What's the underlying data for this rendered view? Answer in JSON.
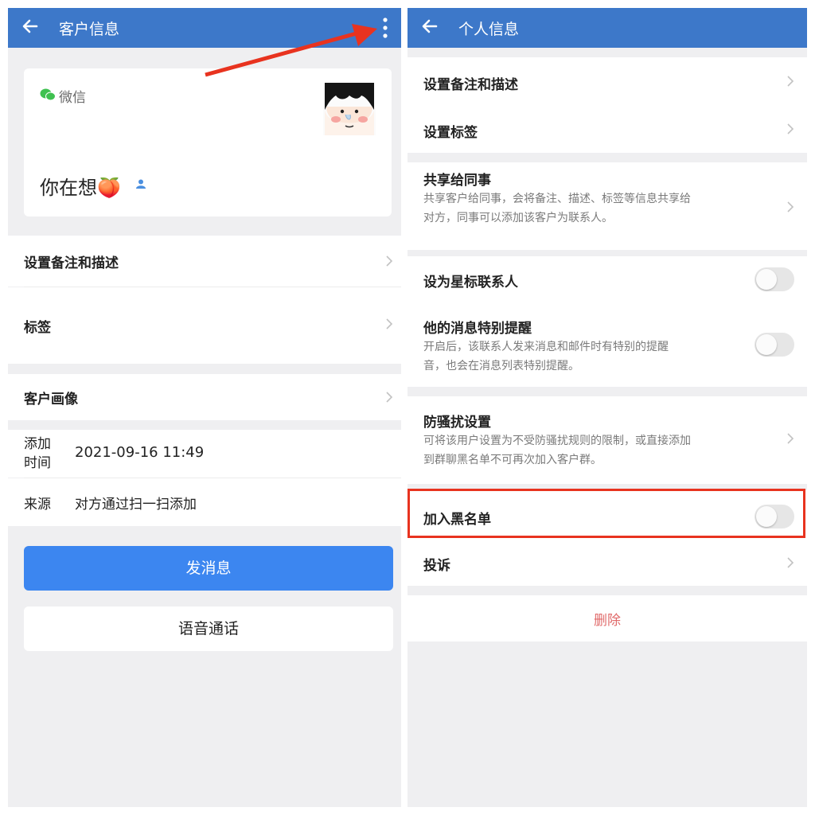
{
  "left": {
    "header": {
      "title": "客户信息"
    },
    "card": {
      "channel_label": "微信",
      "name": "你在想🍑"
    },
    "menu": [
      {
        "label": "设置备注和描述"
      },
      {
        "label": "标签"
      },
      {
        "label": "客户画像"
      }
    ],
    "info": {
      "added_label": "添加\n时间",
      "added_value": "2021-09-16 11:49",
      "source_label": "来源",
      "source_value": "对方通过扫一扫添加"
    },
    "buttons": {
      "send_message": "发消息",
      "voice_call": "语音通话"
    }
  },
  "right": {
    "header": {
      "title": "个人信息"
    },
    "items": {
      "remark": "设置备注和描述",
      "tags": "设置标签",
      "share_title": "共享给同事",
      "share_desc": "共享客户给同事，会将备注、描述、标签等信息共享给对方，同事可以添加该客户为联系人。",
      "star": "设为星标联系人",
      "special_title": "他的消息特别提醒",
      "special_desc": "开启后，该联系人发来消息和邮件时有特别的提醒音，也会在消息列表特别提醒。",
      "anti_title": "防骚扰设置",
      "anti_desc": "可将该用户设置为不受防骚扰规则的限制，或直接添加到群聊黑名单不可再次加入客户群。",
      "blacklist": "加入黑名单",
      "complain": "投诉",
      "delete": "删除"
    },
    "toggles": {
      "star": false,
      "special": false,
      "blacklist": false
    }
  },
  "colors": {
    "header": "#3d78c9",
    "primary_button": "#3c86f0",
    "annotation_red": "#e8331f",
    "delete_text": "#e06a6a",
    "wechat_green": "#3fc150"
  }
}
